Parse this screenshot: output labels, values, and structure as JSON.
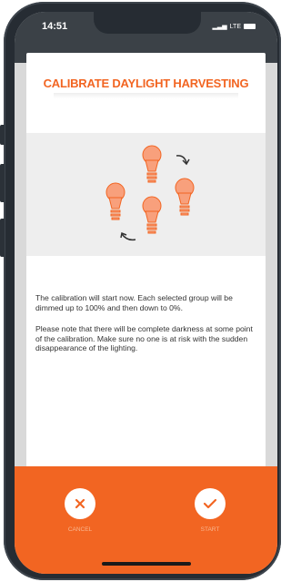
{
  "status_bar": {
    "time": "14:51",
    "network": "LTE"
  },
  "dialog": {
    "title": "CALIBRATE DAYLIGHT HARVESTING",
    "paragraph1": "The calibration will start now. Each selected group will be dimmed up to 100% and then down to 0%.",
    "paragraph2": "Please note that there will be complete darkness at some point of the calibration. Make sure no one is at risk with the sudden disappearance of the lighting."
  },
  "actions": {
    "cancel_label": "CANCEL",
    "start_label": "START"
  },
  "colors": {
    "accent": "#f26522",
    "bulb": "#f8a07c",
    "frame": "#262c33"
  },
  "icons": [
    "close-icon",
    "checkmark-icon",
    "lightbulb-icon",
    "rotate-arrow-icon"
  ]
}
